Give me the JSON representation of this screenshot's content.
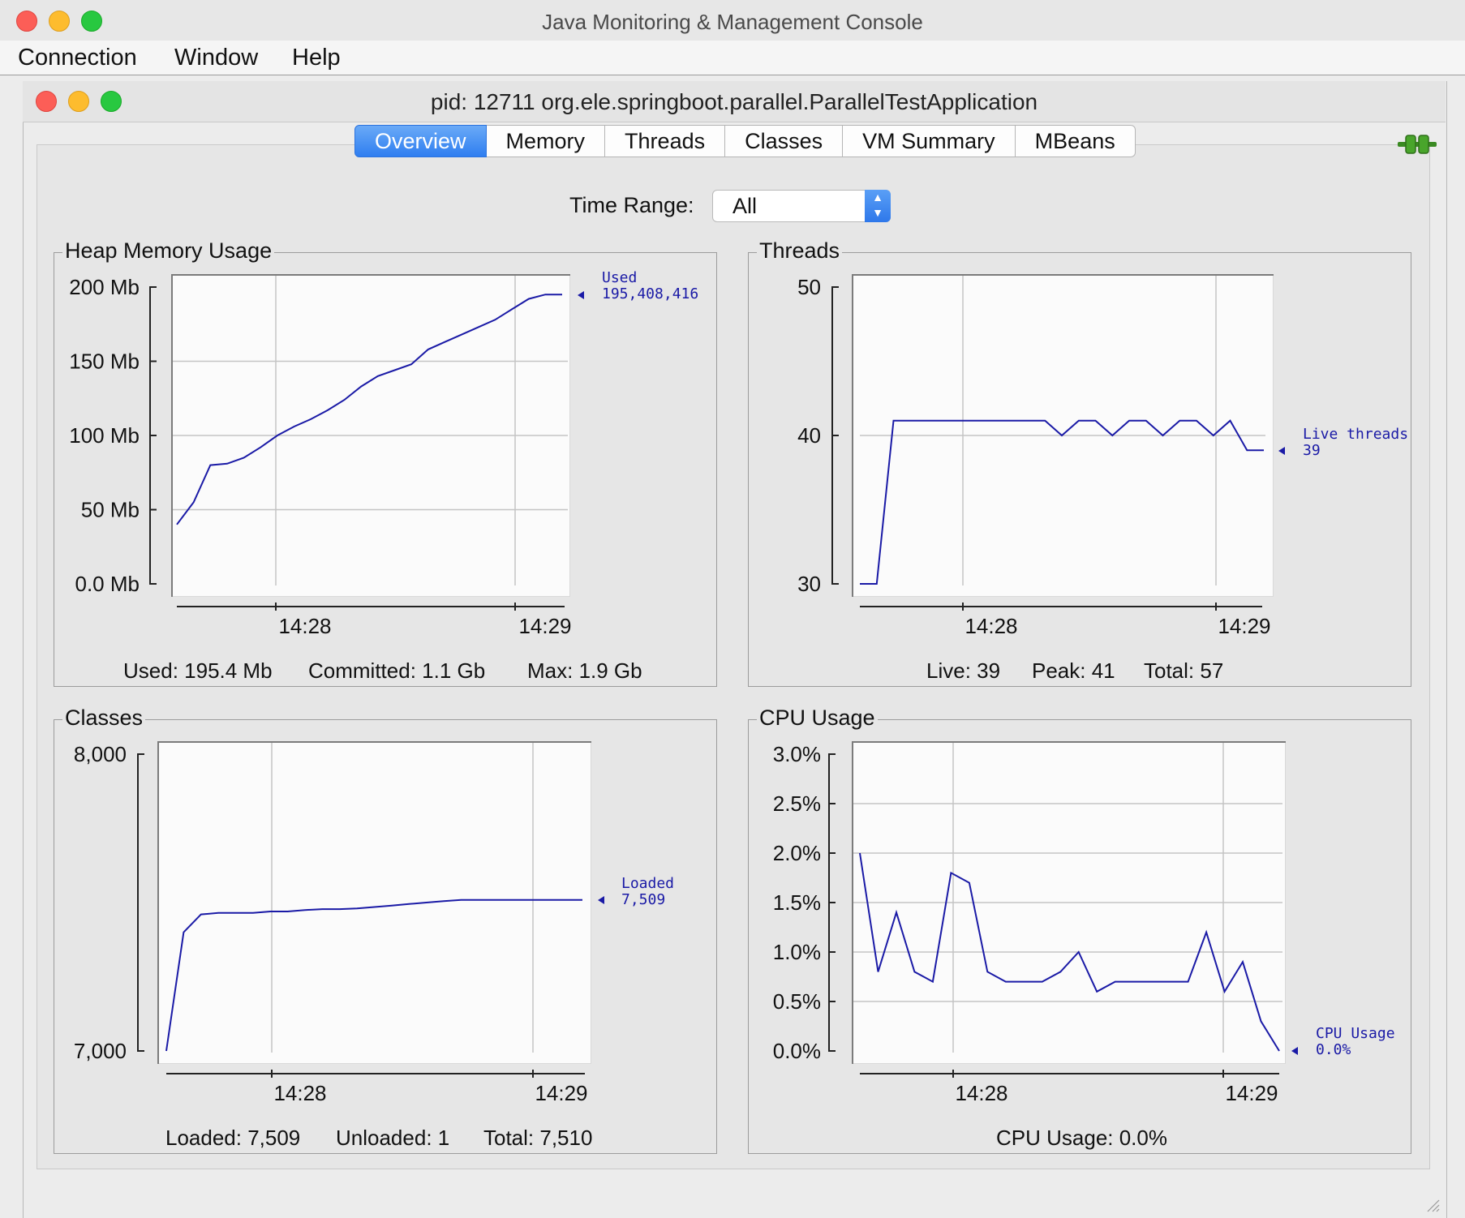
{
  "app": {
    "title": "Java Monitoring & Management Console",
    "menu": [
      "Connection",
      "Window",
      "Help"
    ]
  },
  "inner_window": {
    "title": "pid: 12711 org.ele.springboot.parallel.ParallelTestApplication"
  },
  "tabs": [
    {
      "label": "Overview",
      "active": true
    },
    {
      "label": "Memory",
      "active": false
    },
    {
      "label": "Threads",
      "active": false
    },
    {
      "label": "Classes",
      "active": false
    },
    {
      "label": "VM Summary",
      "active": false
    },
    {
      "label": "MBeans",
      "active": false
    }
  ],
  "time_range": {
    "label": "Time Range:",
    "value": "All"
  },
  "colors": {
    "series": "#1a1aa6",
    "accent": "#2f7ef0",
    "connected": "#49a52b"
  },
  "panels": {
    "heap": {
      "title": "Heap Memory Usage",
      "ytick_labels": [
        "200 Mb",
        "150 Mb",
        "100 Mb",
        "50 Mb",
        "0.0 Mb"
      ],
      "xtick_labels": [
        "14:28",
        "14:29"
      ],
      "series_name": "Used",
      "series_value": "195,408,416",
      "summary": [
        "Used: 195.4 Mb",
        "Committed: 1.1 Gb",
        "Max: 1.9 Gb"
      ]
    },
    "threads": {
      "title": "Threads",
      "ytick_labels": [
        "50",
        "40",
        "30"
      ],
      "xtick_labels": [
        "14:28",
        "14:29"
      ],
      "series_name": "Live threads",
      "series_value": "39",
      "summary": [
        "Live: 39",
        "Peak: 41",
        "Total: 57"
      ]
    },
    "classes": {
      "title": "Classes",
      "ytick_labels": [
        "8,000",
        "7,000"
      ],
      "xtick_labels": [
        "14:28",
        "14:29"
      ],
      "series_name": "Loaded",
      "series_value": "7,509",
      "summary": [
        "Loaded: 7,509",
        "Unloaded: 1",
        "Total: 7,510"
      ]
    },
    "cpu": {
      "title": "CPU Usage",
      "ytick_labels": [
        "3.0%",
        "2.5%",
        "2.0%",
        "1.5%",
        "1.0%",
        "0.5%",
        "0.0%"
      ],
      "xtick_labels": [
        "14:28",
        "14:29"
      ],
      "series_name": "CPU Usage",
      "series_value": "0.0%",
      "summary": [
        "CPU Usage: 0.0%"
      ]
    }
  },
  "chart_data": [
    {
      "type": "line",
      "title": "Heap Memory Usage",
      "ylabel": "Mb",
      "ylim": [
        0,
        200
      ],
      "series": [
        {
          "name": "Used",
          "values": [
            40,
            55,
            80,
            81,
            85,
            92,
            100,
            106,
            111,
            117,
            124,
            133,
            140,
            144,
            148,
            158,
            163,
            168,
            173,
            178,
            185,
            192,
            195,
            195
          ]
        }
      ]
    },
    {
      "type": "line",
      "title": "Threads",
      "ylim": [
        30,
        50
      ],
      "series": [
        {
          "name": "Live threads",
          "values": [
            30,
            30,
            41,
            41,
            41,
            41,
            41,
            41,
            41,
            41,
            41,
            41,
            40,
            41,
            41,
            40,
            41,
            41,
            40,
            41,
            41,
            40,
            41,
            39,
            39
          ]
        }
      ]
    },
    {
      "type": "line",
      "title": "Classes",
      "ylim": [
        7000,
        8000
      ],
      "series": [
        {
          "name": "Loaded",
          "values": [
            7000,
            7400,
            7460,
            7465,
            7465,
            7465,
            7470,
            7470,
            7475,
            7478,
            7478,
            7480,
            7485,
            7490,
            7495,
            7500,
            7505,
            7509,
            7509,
            7509,
            7509,
            7509,
            7509,
            7509,
            7509
          ]
        }
      ]
    },
    {
      "type": "line",
      "title": "CPU Usage",
      "ylabel": "%",
      "ylim": [
        0,
        3.0
      ],
      "series": [
        {
          "name": "CPU Usage",
          "values": [
            2.0,
            0.8,
            1.4,
            0.8,
            0.7,
            1.8,
            1.7,
            0.8,
            0.7,
            0.7,
            0.7,
            0.8,
            1.0,
            0.6,
            0.7,
            0.7,
            0.7,
            0.7,
            0.7,
            1.2,
            0.6,
            0.9,
            0.3,
            0.0
          ]
        }
      ]
    }
  ]
}
